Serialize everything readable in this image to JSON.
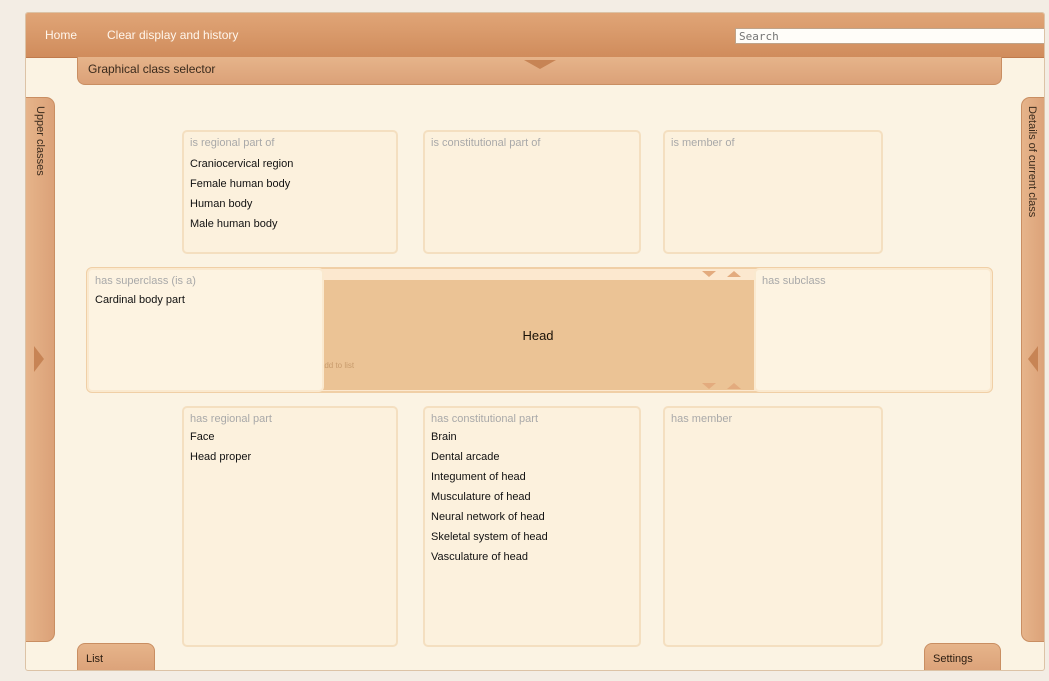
{
  "nav": {
    "home": "Home",
    "clear": "Clear display and history",
    "search_placeholder": "Search"
  },
  "selector": {
    "title": "Graphical class selector"
  },
  "side_tabs": {
    "left": "Upper classes",
    "right": "Details of current class"
  },
  "boxes": {
    "regional_part_of": {
      "label": "is regional part of",
      "items": [
        "Craniocervical region",
        "Female human body",
        "Human body",
        "Male human body"
      ]
    },
    "constitutional_part_of": {
      "label": "is constitutional part of",
      "items": []
    },
    "member_of": {
      "label": "is member of",
      "items": []
    },
    "superclass": {
      "label": "has superclass (is a)",
      "items": [
        "Cardinal body part"
      ]
    },
    "subclass": {
      "label": "has subclass",
      "items": []
    },
    "regional_part": {
      "label": "has regional part",
      "items": [
        "Face",
        "Head proper"
      ]
    },
    "constitutional_part": {
      "label": "has constitutional part",
      "items": [
        "Brain",
        "Dental arcade",
        "Integument of head",
        "Musculature of head",
        "Neural network of head",
        "Skeletal system of head",
        "Vasculature of head"
      ]
    },
    "member": {
      "label": "has member",
      "items": []
    }
  },
  "current_class": {
    "name": "Head",
    "add_to_list": "Add to list"
  },
  "bottom_tabs": {
    "list": "List",
    "settings": "Settings"
  },
  "colors": {
    "accent": "#d08c5c",
    "panel": "#fcf1dd",
    "center": "#ebc395"
  }
}
